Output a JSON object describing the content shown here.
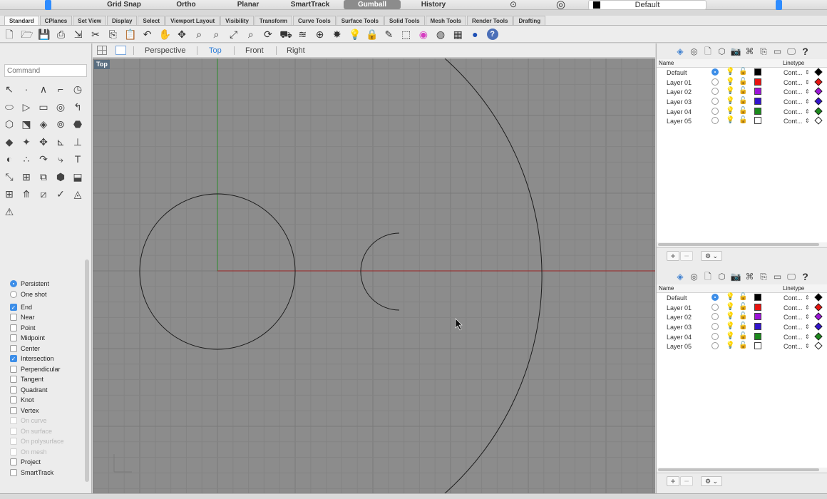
{
  "topbar": {
    "toggles": [
      {
        "label": "Grid Snap",
        "active": false
      },
      {
        "label": "Ortho",
        "active": false
      },
      {
        "label": "Planar",
        "active": false
      },
      {
        "label": "SmartTrack",
        "active": false
      },
      {
        "label": "Gumball",
        "active": true
      },
      {
        "label": "History",
        "active": false
      }
    ],
    "current_layer": "Default",
    "current_layer_color": "#000000"
  },
  "tabs": [
    "Standard",
    "CPlanes",
    "Set View",
    "Display",
    "Select",
    "Viewport Layout",
    "Visibility",
    "Transform",
    "Curve Tools",
    "Surface Tools",
    "Solid Tools",
    "Mesh Tools",
    "Render Tools",
    "Drafting"
  ],
  "active_tab": "Standard",
  "toolbar_icons": [
    "new-file-icon",
    "open-folder-icon",
    "save-icon",
    "print-icon",
    "import-icon",
    "cut-icon",
    "copy-icon",
    "paste-icon",
    "undo-icon",
    "pan-hand-icon",
    "move-view-icon",
    "zoom-icon",
    "zoom-window-icon",
    "zoom-extents-icon",
    "zoom-selected-icon",
    "rotate-view-icon",
    "car-icon",
    "layer-icon",
    "cplane-icon",
    "point-icon",
    "light-icon",
    "lock-icon",
    "properties-icon",
    "select-icon",
    "color-wheel-icon",
    "sphere-shaded-icon",
    "render-icon",
    "material-sphere-icon",
    "help-icon"
  ],
  "command": {
    "placeholder": "Command"
  },
  "viewport_tabs": {
    "items": [
      "Perspective",
      "Top",
      "Front",
      "Right"
    ],
    "active": "Top"
  },
  "viewport": {
    "label": "Top"
  },
  "osnap": {
    "mode": [
      {
        "label": "Persistent",
        "selected": true
      },
      {
        "label": "One shot",
        "selected": false
      }
    ],
    "snaps": [
      {
        "label": "End",
        "checked": true,
        "enabled": true
      },
      {
        "label": "Near",
        "checked": false,
        "enabled": true
      },
      {
        "label": "Point",
        "checked": false,
        "enabled": true
      },
      {
        "label": "Midpoint",
        "checked": false,
        "enabled": true
      },
      {
        "label": "Center",
        "checked": false,
        "enabled": true
      },
      {
        "label": "Intersection",
        "checked": true,
        "enabled": true
      },
      {
        "label": "Perpendicular",
        "checked": false,
        "enabled": true
      },
      {
        "label": "Tangent",
        "checked": false,
        "enabled": true
      },
      {
        "label": "Quadrant",
        "checked": false,
        "enabled": true
      },
      {
        "label": "Knot",
        "checked": false,
        "enabled": true
      },
      {
        "label": "Vertex",
        "checked": false,
        "enabled": true
      },
      {
        "label": "On curve",
        "checked": false,
        "enabled": false
      },
      {
        "label": "On surface",
        "checked": false,
        "enabled": false
      },
      {
        "label": "On polysurface",
        "checked": false,
        "enabled": false
      },
      {
        "label": "On mesh",
        "checked": false,
        "enabled": false
      },
      {
        "label": "Project",
        "checked": false,
        "enabled": true
      },
      {
        "label": "SmartTrack",
        "checked": false,
        "enabled": true
      }
    ]
  },
  "layers": {
    "header_name": "Name",
    "header_linetype": "Linetype",
    "rows": [
      {
        "name": "Default",
        "current": true,
        "color": "#000000",
        "linetype": "Cont...",
        "print_color": "#000000"
      },
      {
        "name": "Layer 01",
        "current": false,
        "color": "#e8130f",
        "linetype": "Cont...",
        "print_color": "#e8130f"
      },
      {
        "name": "Layer 02",
        "current": false,
        "color": "#9b14d8",
        "linetype": "Cont...",
        "print_color": "#9b14d8"
      },
      {
        "name": "Layer 03",
        "current": false,
        "color": "#3314cc",
        "linetype": "Cont...",
        "print_color": "#3314cc"
      },
      {
        "name": "Layer 04",
        "current": false,
        "color": "#1d8a1d",
        "linetype": "Cont...",
        "print_color": "#1d8a1d"
      },
      {
        "name": "Layer 05",
        "current": false,
        "color": "#ffffff",
        "linetype": "Cont...",
        "print_color": "#ffffff"
      }
    ],
    "add_label": "+",
    "remove_label": "−",
    "gear_label": "⚙ ⌄"
  },
  "panel_icons": [
    "layers-panel-icon",
    "display-panel-icon",
    "page-panel-icon",
    "object-panel-icon",
    "camera-panel-icon",
    "named-views-icon",
    "layout-panel-icon",
    "window-panel-icon",
    "screen-panel-icon",
    "help-panel-icon"
  ]
}
